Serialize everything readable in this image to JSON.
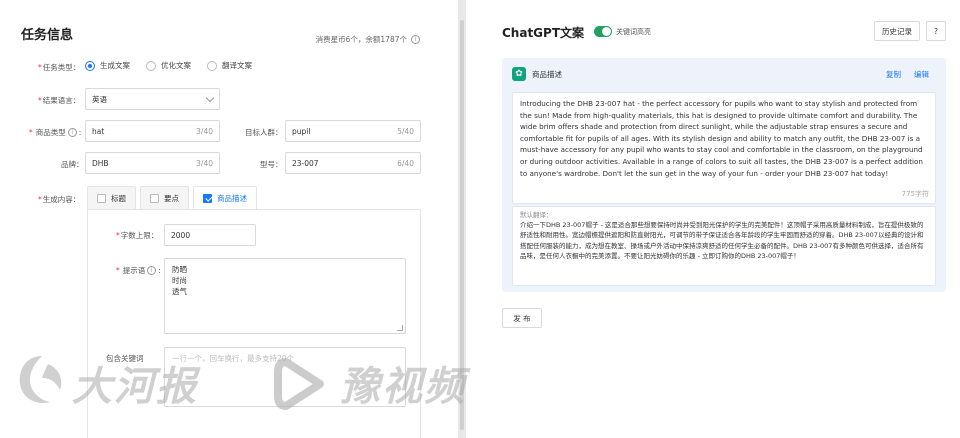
{
  "task": {
    "title": "任务信息",
    "quota": "消费星币6个，余额1787个",
    "task_type_label": "任务类型：",
    "task_types": [
      "生成文案",
      "优化文案",
      "翻译文案"
    ],
    "result_lang_label": "结果语言：",
    "result_lang": "英语",
    "category_label": "商品类型",
    "category_value": "hat",
    "category_count": "3/40",
    "audience_label": "目标人群：",
    "audience_value": "pupil",
    "audience_count": "5/40",
    "brand_label": "品牌：",
    "brand_value": "DHB",
    "brand_count": "3/40",
    "model_label": "型号：",
    "model_value": "23-007",
    "model_count": "6/40",
    "content_label": "生成内容：",
    "tabs": [
      {
        "label": "标题",
        "checked": false
      },
      {
        "label": "要点",
        "checked": false
      },
      {
        "label": "商品描述",
        "checked": true
      }
    ],
    "wordlimit_label": "字数上限：",
    "wordlimit_value": "2000",
    "hint_label": "提示语",
    "hint_lines": [
      "防晒",
      "时尚",
      "透气"
    ],
    "keywords_label": "包含关键词",
    "keywords_placeholder": "一行一个，回车换行，最多支持20个"
  },
  "gpt": {
    "title": "ChatGPT文案",
    "toggle_label": "关键词高亮",
    "history_button": "历史记录",
    "help_button": "?",
    "card_title": "商品描述",
    "copy_link": "复制",
    "edit_link": "编辑",
    "body": "Introducing the DHB 23-007 hat - the perfect accessory for pupils who want to stay stylish and protected from the sun! Made from high-quality materials, this hat is designed to provide ultimate comfort and durability. The wide brim offers shade and protection from direct sunlight, while the adjustable strap ensures a secure and comfortable fit for pupils of all ages. With its stylish design and ability to match any outfit, the DHB 23-007 is a must-have accessory for any pupil who wants to stay cool and comfortable in the classroom, on the playground or during outdoor activities. Available in a range of colors to suit all tastes, the DHB 23-007 is a perfect addition to anyone's wardrobe. Don't let the sun get in the way of your fun - order your DHB 23-007 hat today!",
    "char_count": "775字符",
    "translation_label": "默认翻译：",
    "translation": "介绍一下DHB 23-007帽子 - 这是适合那些想要保持时尚并受到阳光保护的学生的完美配件！这顶帽子采用高质量材料制成，旨在提供极致的舒适性和耐用性。宽边帽檐提供遮阳和防直射阳光，可调节的带子保证适合各年龄段的学生牢固而舒适的穿着。DHB 23-007以经典的设计和搭配任何服装的能力，成为想在教室、操场或户外活动中保持凉爽舒适的任何学生必备的配件。DHB 23-007有多种颜色可供选择，适合所有品味，是任何人衣橱中的完美添置。不要让阳光妨碍你的乐趣 - 立即订购你的DHB 23-007帽子！",
    "publish_button": "发 布"
  },
  "watermark": {
    "left": "大河报",
    "right": "豫视频"
  },
  "colors": {
    "accent": "#1677ff",
    "toggle": "#20a162",
    "card_bg": "#edf2fb"
  }
}
